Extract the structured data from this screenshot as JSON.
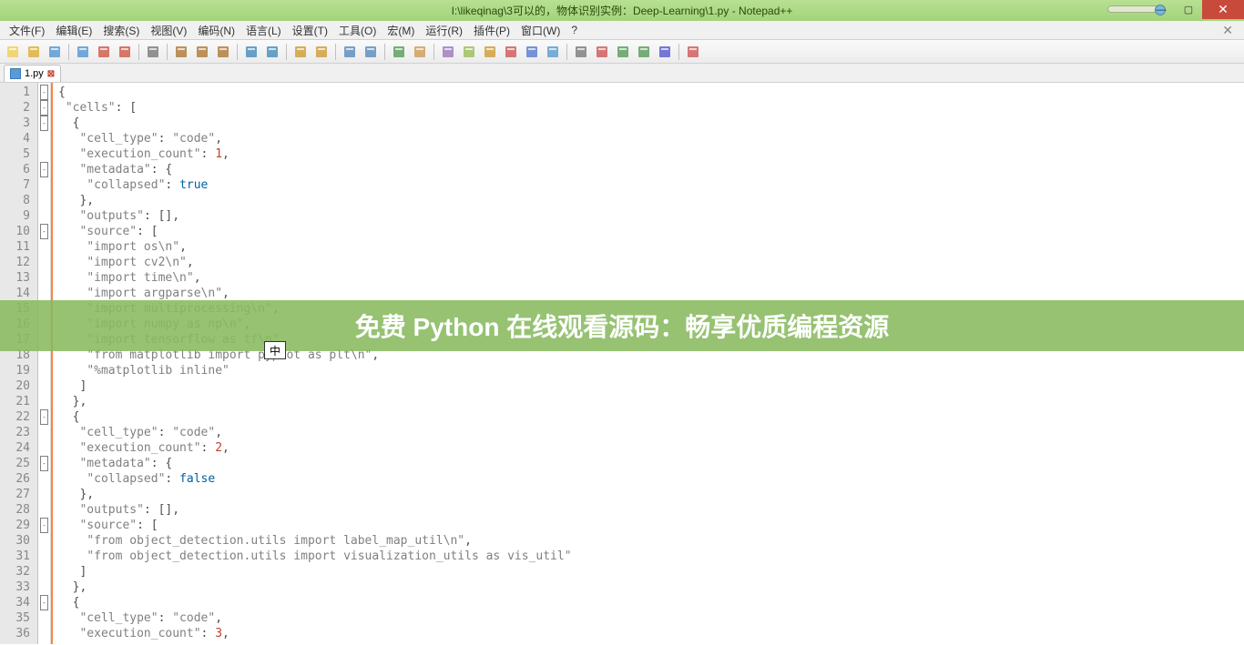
{
  "title": "I:\\likeqinag\\3可以的，物体识别实例：Deep-Learning\\1.py - Notepad++",
  "menubar": [
    "文件(F)",
    "编辑(E)",
    "搜索(S)",
    "视图(V)",
    "编码(N)",
    "语言(L)",
    "设置(T)",
    "工具(O)",
    "宏(M)",
    "运行(R)",
    "插件(P)",
    "窗口(W)",
    "?"
  ],
  "tab": {
    "label": "1.py"
  },
  "banner_text": "免费 Python 在线观看源码：畅享优质编程资源",
  "ime": "中",
  "winctrl": {
    "min": "—",
    "max": "▢",
    "close": "✕",
    "menuclose": "✕"
  },
  "lines": [
    {
      "n": 1,
      "fold": "-",
      "t": [
        [
          "punct",
          "{"
        ]
      ]
    },
    {
      "n": 2,
      "fold": "-",
      "t": [
        [
          "punct",
          " "
        ],
        [
          "str",
          "\"cells\""
        ],
        [
          "punct",
          ": ["
        ]
      ]
    },
    {
      "n": 3,
      "fold": "-",
      "t": [
        [
          "punct",
          "  {"
        ]
      ]
    },
    {
      "n": 4,
      "fold": "",
      "t": [
        [
          "punct",
          "   "
        ],
        [
          "str",
          "\"cell_type\""
        ],
        [
          "punct",
          ": "
        ],
        [
          "str",
          "\"code\""
        ],
        [
          "punct",
          ","
        ]
      ]
    },
    {
      "n": 5,
      "fold": "",
      "t": [
        [
          "punct",
          "   "
        ],
        [
          "str",
          "\"execution_count\""
        ],
        [
          "punct",
          ": "
        ],
        [
          "num",
          "1"
        ],
        [
          "punct",
          ","
        ]
      ]
    },
    {
      "n": 6,
      "fold": "-",
      "t": [
        [
          "punct",
          "   "
        ],
        [
          "str",
          "\"metadata\""
        ],
        [
          "punct",
          ": {"
        ]
      ]
    },
    {
      "n": 7,
      "fold": "",
      "t": [
        [
          "punct",
          "    "
        ],
        [
          "str",
          "\"collapsed\""
        ],
        [
          "punct",
          ": "
        ],
        [
          "kw",
          "true"
        ]
      ]
    },
    {
      "n": 8,
      "fold": "",
      "t": [
        [
          "punct",
          "   },"
        ]
      ]
    },
    {
      "n": 9,
      "fold": "",
      "t": [
        [
          "punct",
          "   "
        ],
        [
          "str",
          "\"outputs\""
        ],
        [
          "punct",
          ": [],"
        ]
      ]
    },
    {
      "n": 10,
      "fold": "-",
      "t": [
        [
          "punct",
          "   "
        ],
        [
          "str",
          "\"source\""
        ],
        [
          "punct",
          ": ["
        ]
      ]
    },
    {
      "n": 11,
      "fold": "",
      "t": [
        [
          "punct",
          "    "
        ],
        [
          "str",
          "\"import os\\n\""
        ],
        [
          "punct",
          ","
        ]
      ]
    },
    {
      "n": 12,
      "fold": "",
      "t": [
        [
          "punct",
          "    "
        ],
        [
          "str",
          "\"import cv2\\n\""
        ],
        [
          "punct",
          ","
        ]
      ]
    },
    {
      "n": 13,
      "fold": "",
      "t": [
        [
          "punct",
          "    "
        ],
        [
          "str",
          "\"import time\\n\""
        ],
        [
          "punct",
          ","
        ]
      ]
    },
    {
      "n": 14,
      "fold": "",
      "t": [
        [
          "punct",
          "    "
        ],
        [
          "str",
          "\"import argparse\\n\""
        ],
        [
          "punct",
          ","
        ]
      ]
    },
    {
      "n": 15,
      "fold": "",
      "t": [
        [
          "punct",
          "    "
        ],
        [
          "str",
          "\"import multiprocessing\\n\""
        ],
        [
          "punct",
          ","
        ]
      ]
    },
    {
      "n": 16,
      "fold": "",
      "t": [
        [
          "punct",
          "    "
        ],
        [
          "str",
          "\"import numpy as np\\n\""
        ],
        [
          "punct",
          ","
        ]
      ]
    },
    {
      "n": 17,
      "fold": "",
      "t": [
        [
          "punct",
          "    "
        ],
        [
          "str",
          "\"import tensorflow as tf\\n\""
        ],
        [
          "punct",
          ","
        ]
      ]
    },
    {
      "n": 18,
      "fold": "",
      "t": [
        [
          "punct",
          "    "
        ],
        [
          "str",
          "\"from matplotlib import pyplot as plt\\n\""
        ],
        [
          "punct",
          ","
        ]
      ]
    },
    {
      "n": 19,
      "fold": "",
      "t": [
        [
          "punct",
          "    "
        ],
        [
          "str",
          "\"%matplotlib inline\""
        ]
      ]
    },
    {
      "n": 20,
      "fold": "",
      "t": [
        [
          "punct",
          "   ]"
        ]
      ]
    },
    {
      "n": 21,
      "fold": "",
      "t": [
        [
          "punct",
          "  },"
        ]
      ]
    },
    {
      "n": 22,
      "fold": "-",
      "t": [
        [
          "punct",
          "  {"
        ]
      ]
    },
    {
      "n": 23,
      "fold": "",
      "t": [
        [
          "punct",
          "   "
        ],
        [
          "str",
          "\"cell_type\""
        ],
        [
          "punct",
          ": "
        ],
        [
          "str",
          "\"code\""
        ],
        [
          "punct",
          ","
        ]
      ]
    },
    {
      "n": 24,
      "fold": "",
      "t": [
        [
          "punct",
          "   "
        ],
        [
          "str",
          "\"execution_count\""
        ],
        [
          "punct",
          ": "
        ],
        [
          "num",
          "2"
        ],
        [
          "punct",
          ","
        ]
      ]
    },
    {
      "n": 25,
      "fold": "-",
      "t": [
        [
          "punct",
          "   "
        ],
        [
          "str",
          "\"metadata\""
        ],
        [
          "punct",
          ": {"
        ]
      ]
    },
    {
      "n": 26,
      "fold": "",
      "t": [
        [
          "punct",
          "    "
        ],
        [
          "str",
          "\"collapsed\""
        ],
        [
          "punct",
          ": "
        ],
        [
          "kw",
          "false"
        ]
      ]
    },
    {
      "n": 27,
      "fold": "",
      "t": [
        [
          "punct",
          "   },"
        ]
      ]
    },
    {
      "n": 28,
      "fold": "",
      "t": [
        [
          "punct",
          "   "
        ],
        [
          "str",
          "\"outputs\""
        ],
        [
          "punct",
          ": [],"
        ]
      ]
    },
    {
      "n": 29,
      "fold": "-",
      "t": [
        [
          "punct",
          "   "
        ],
        [
          "str",
          "\"source\""
        ],
        [
          "punct",
          ": ["
        ]
      ]
    },
    {
      "n": 30,
      "fold": "",
      "t": [
        [
          "punct",
          "    "
        ],
        [
          "str",
          "\"from object_detection.utils import label_map_util\\n\""
        ],
        [
          "punct",
          ","
        ]
      ]
    },
    {
      "n": 31,
      "fold": "",
      "t": [
        [
          "punct",
          "    "
        ],
        [
          "str",
          "\"from object_detection.utils import visualization_utils as vis_util\""
        ]
      ]
    },
    {
      "n": 32,
      "fold": "",
      "t": [
        [
          "punct",
          "   ]"
        ]
      ]
    },
    {
      "n": 33,
      "fold": "",
      "t": [
        [
          "punct",
          "  },"
        ]
      ]
    },
    {
      "n": 34,
      "fold": "-",
      "t": [
        [
          "punct",
          "  {"
        ]
      ]
    },
    {
      "n": 35,
      "fold": "",
      "t": [
        [
          "punct",
          "   "
        ],
        [
          "str",
          "\"cell_type\""
        ],
        [
          "punct",
          ": "
        ],
        [
          "str",
          "\"code\""
        ],
        [
          "punct",
          ","
        ]
      ]
    },
    {
      "n": 36,
      "fold": "",
      "t": [
        [
          "punct",
          "   "
        ],
        [
          "str",
          "\"execution_count\""
        ],
        [
          "punct",
          ": "
        ],
        [
          "num",
          "3"
        ],
        [
          "punct",
          ","
        ]
      ]
    }
  ],
  "toolbar_icons": [
    "new-file",
    "open-file",
    "save-file",
    "save-all",
    "close-file",
    "close-all",
    "print",
    "cut",
    "copy",
    "paste",
    "undo",
    "redo",
    "find",
    "replace",
    "zoom-in",
    "zoom-out",
    "sync",
    "word-wrap",
    "show-all",
    "indent-guide",
    "folder",
    "language",
    "function-list",
    "doc-map",
    "monitor",
    "record-macro",
    "play-macro",
    "replay",
    "save-macro",
    "spell-check"
  ]
}
